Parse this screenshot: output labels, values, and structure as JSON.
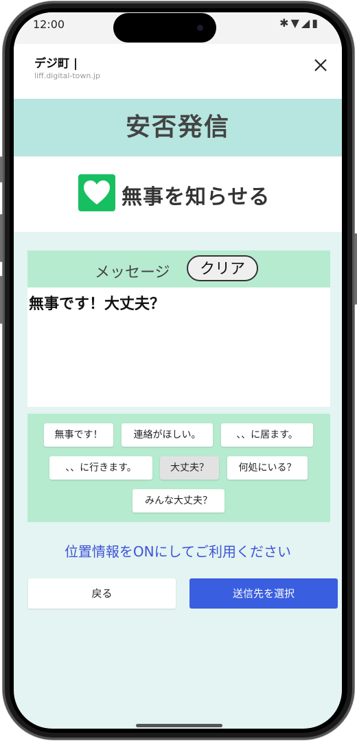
{
  "status_bar": {
    "time": "12:00",
    "icons": [
      "bluetooth-icon",
      "wifi-icon",
      "signal-icon",
      "battery-icon"
    ]
  },
  "app_bar": {
    "title": "デジ町 |",
    "url": "liff.digital-town.jp",
    "close_icon": "close-icon"
  },
  "header": {
    "title": "安否発信"
  },
  "mode": {
    "label": "無事を知らせる",
    "icon": "heart-icon",
    "icon_color": "#16c060"
  },
  "message": {
    "label": "メッセージ",
    "clear_label": "クリア",
    "value": "無事です！大丈夫？"
  },
  "phrases": [
    {
      "label": "無事です！",
      "selected": false
    },
    {
      "label": "連絡がほしい。",
      "selected": false
    },
    {
      "label": "、、に居ます。",
      "selected": false
    },
    {
      "label": "、、に行きます。",
      "selected": false
    },
    {
      "label": "大丈夫？",
      "selected": true
    },
    {
      "label": "何処にいる？",
      "selected": false
    },
    {
      "label": "みんな大丈夫？",
      "selected": false
    }
  ],
  "hint": "位置情報をONにしてご利用ください",
  "buttons": {
    "back": "戻る",
    "next": "送信先を選択"
  },
  "colors": {
    "header_bg": "#b7e5df",
    "page_bg": "#e3f4f2",
    "panel_bg": "#b7ebd0",
    "primary": "#3a5ee0",
    "hint_text": "#3f52d8"
  }
}
